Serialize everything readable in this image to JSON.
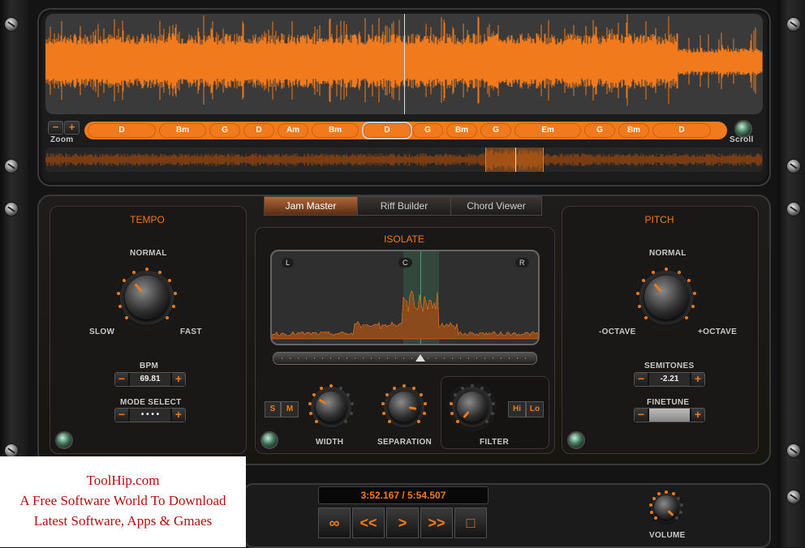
{
  "app": {
    "accent_color": "#f07a1c",
    "background_color": "#141414"
  },
  "waveform": {
    "zoom_label": "Zoom",
    "scroll_label": "Scroll",
    "zoom_minus": "−",
    "zoom_plus": "+",
    "chords": [
      {
        "label": "D"
      },
      {
        "label": "Bm"
      },
      {
        "label": "G"
      },
      {
        "label": "D"
      },
      {
        "label": "Am"
      },
      {
        "label": "Bm"
      },
      {
        "label": "D",
        "active": true
      },
      {
        "label": "G"
      },
      {
        "label": "Bm"
      },
      {
        "label": "G"
      },
      {
        "label": "Em"
      },
      {
        "label": "G"
      },
      {
        "label": "Bm"
      },
      {
        "label": "D"
      }
    ]
  },
  "tabs": [
    "Jam Master",
    "Riff Builder",
    "Chord Viewer"
  ],
  "tempo": {
    "title": "TEMPO",
    "knob_top_label": "NORMAL",
    "knob_left_label": "SLOW",
    "knob_right_label": "FAST",
    "bpm_label": "BPM",
    "bpm_value": "69.81",
    "mode_label": "MODE SELECT",
    "mode_value": "• • • •"
  },
  "isolate": {
    "title": "ISOLATE",
    "channel_left": "L",
    "channel_center": "C",
    "channel_right": "R",
    "solo_label": "S",
    "mute_label": "M",
    "width_label": "WIDTH",
    "separation_label": "SEPARATION",
    "filter_label": "FILTER",
    "hi_label": "Hi",
    "lo_label": "Lo"
  },
  "pitch": {
    "title": "PITCH",
    "knob_top_label": "NORMAL",
    "knob_left_label": "-OCTAVE",
    "knob_right_label": "+OCTAVE",
    "semitones_label": "SEMITONES",
    "semitones_value": "-2.21",
    "finetune_label": "FINETUNE",
    "finetune_value": ""
  },
  "transport": {
    "time_display": "3:52.167 / 5:54.507",
    "loop_icon": "∞",
    "rewind_label": "<<",
    "play_label": ">",
    "forward_label": ">>",
    "stop_icon": "□",
    "volume_label": "VOLUME"
  },
  "watermark": {
    "line1": "ToolHip.com",
    "line2": "A Free Software World To Download",
    "line3": "Latest Software, Apps & Gmaes"
  }
}
